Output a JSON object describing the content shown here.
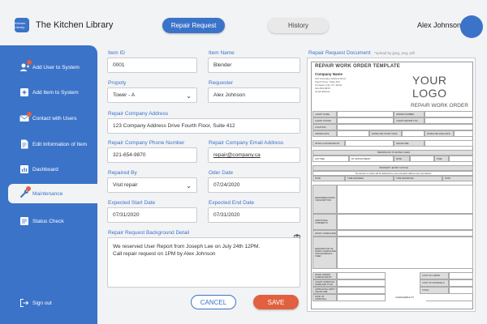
{
  "app": {
    "title": "The Kitchen Library",
    "logo_text": "Kitchen Library"
  },
  "tabs": {
    "active": "Repair Request",
    "inactive": "History"
  },
  "user": {
    "name": "Alex Johnson"
  },
  "sidebar": {
    "items": [
      {
        "label": "Add User to System",
        "icon": "add-user-icon"
      },
      {
        "label": "Add Item to System",
        "icon": "add-item-icon"
      },
      {
        "label": "Contact with Users",
        "icon": "mail-icon"
      },
      {
        "label": "Edit Information of Item",
        "icon": "document-icon"
      },
      {
        "label": "Dashboard",
        "icon": "dashboard-icon"
      },
      {
        "label": "Maintenance",
        "icon": "wrench-icon"
      },
      {
        "label": "Status Check",
        "icon": "status-icon"
      }
    ],
    "signout": "Sign out"
  },
  "form": {
    "item_id": {
      "label": "Item ID",
      "value": "0001"
    },
    "item_name": {
      "label": "Item Name",
      "value": "Blender"
    },
    "property": {
      "label": "Propoty",
      "value": "Tower - A"
    },
    "requester": {
      "label": "Requester",
      "value": "Alex Johnson"
    },
    "company_address": {
      "label": "Repair Company Address",
      "value": "123 Company Address Drive Fourth Floor, Suite 412"
    },
    "company_phone": {
      "label": "Repair Company Phone Number",
      "value": "321-654-9870"
    },
    "company_email": {
      "label": "Repair Company Email Address",
      "value": "repair@company.ca"
    },
    "repaired_by": {
      "label": "Repaired By",
      "value": "Visit repair"
    },
    "order_date": {
      "label": "Oder Date",
      "value": "07/24/2020"
    },
    "start_date": {
      "label": "Expected Start Date",
      "value": "07/31/2020"
    },
    "end_date": {
      "label": "Expected End Date",
      "value": "07/31/2020"
    },
    "background": {
      "label": "Repair Request Background Detail",
      "line1": "We reserved User Report from Joseph Lee on July 24th 12PM.",
      "line2": "Call repair request on 1PM by Alex Johnson"
    },
    "cancel_label": "CANCEL",
    "save_label": "SAVE"
  },
  "document": {
    "label": "Repair Request Document",
    "hint": "*upload by jpeg, png, pdf",
    "title": "REPAIR WORK ORDER TEMPLATE",
    "company_name": "Company Name",
    "address_lines": [
      "123 Company Address Drive",
      "Fourth Floor, Suite 412",
      "Company City, NY 11101",
      "321-654-9870",
      "email address"
    ],
    "logo": "YOUR LOGO",
    "work_order": "REPAIR WORK ORDER",
    "rows": {
      "client_name": "CLIENT NAME",
      "client_phone": "CLIENT PHONE",
      "order_date": "ORDER DATE",
      "order_number": "ORDER NUMBER",
      "client_receipt": "CLIENT RECEIPT NO.",
      "location": "LOCATION",
      "expected_start": "EXPECTED START DATE",
      "expected_end": "EXPECTED END DATE",
      "work_authorized": "WORK AUTHORIZED BY",
      "signature": "SIGNATURE",
      "permission": "PERMISSION TO ENTER GIVEN",
      "anytime": "ANYTIME",
      "by_appointment": "BY APPOINTMENT",
      "date": "DATE",
      "time": "TIME",
      "property_entry": "PROPERTY ENTRY NOTICE",
      "notice": "No service or notice will be delivered to your premises without your permission.",
      "time_entered": "TIME ENTERED",
      "time_departed": "TIME DEPARTED",
      "described_work": "DESCRIBED WORK / DESCRIPTION",
      "additional": "ADDITIONAL COMMENTS",
      "work_completed": "WORK COMPLETED",
      "description_work": "DESCRIPTION OF WORK COMPLETED AND MATERIALS USED",
      "work_order_completed": "WORK ORDER COMPLETED BY",
      "client_approval": "CLIENT APPROVAL NAME AND TITLE",
      "approving_party": "APPROVING PARTY SIGNATURE",
      "date_approval": "DATE OF APPROVAL",
      "cost_labor": "COST OF LABOR",
      "cost_materials": "COST OF MATERIALS",
      "total": "TOTAL",
      "charges_to": "CHARGEABLE TO"
    }
  },
  "colors": {
    "accent": "#3b73c9",
    "save": "#e0603f",
    "background": "#f2f3f5"
  }
}
